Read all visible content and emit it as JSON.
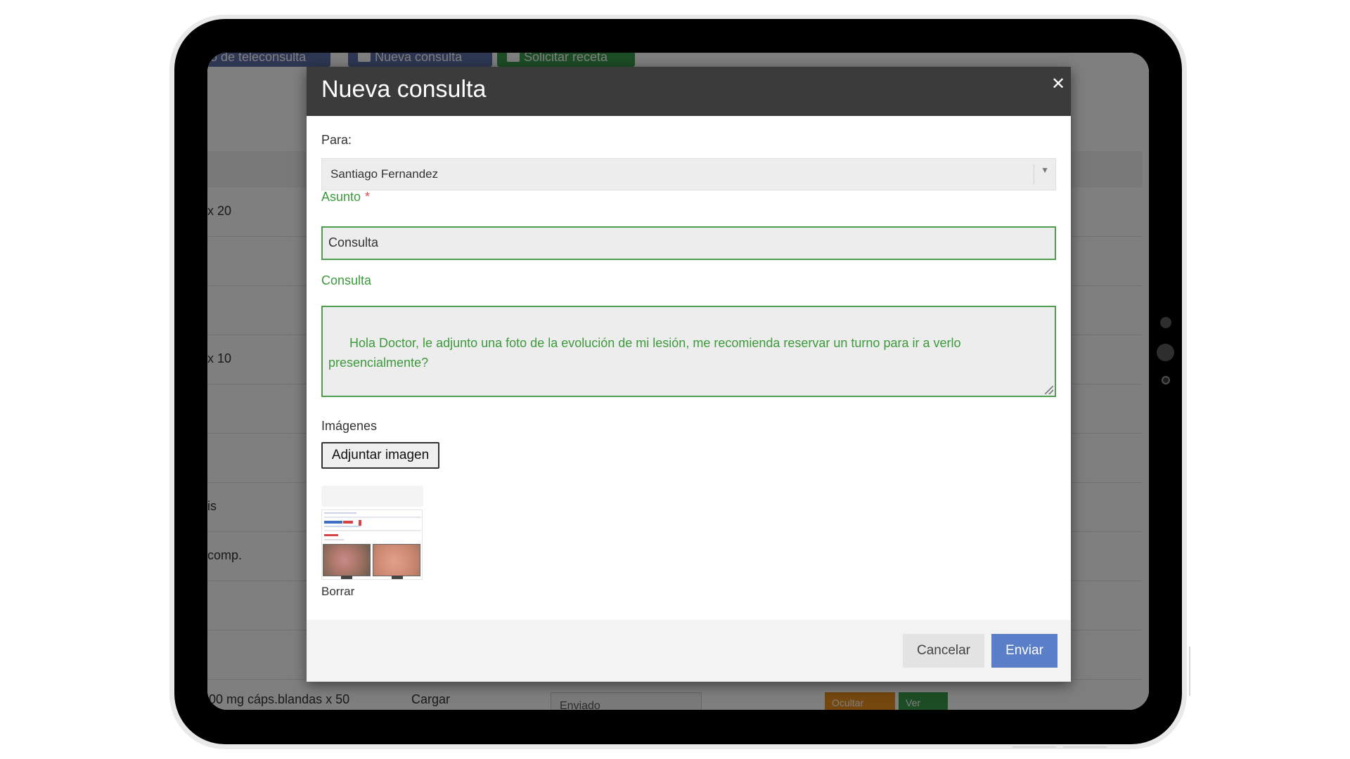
{
  "background": {
    "tabs": [
      {
        "label": "o de teleconsulta"
      },
      {
        "label": "Nueva consulta",
        "icon": "envelope-icon"
      },
      {
        "label": "Solicitar receta",
        "icon": "plus-icon"
      }
    ],
    "rows": [
      {
        "text": "x 20"
      },
      {
        "text": ""
      },
      {
        "text": ""
      },
      {
        "text": "x 10"
      },
      {
        "text": ""
      },
      {
        "text": ""
      },
      {
        "text": "is"
      },
      {
        "text": "comp."
      },
      {
        "text": ""
      },
      {
        "text": ""
      }
    ],
    "last_row": {
      "medication": "00 mg cáps.blandas x 50",
      "action": "Cargar",
      "status": "Enviado",
      "hide_label": "Ocultar",
      "view_label": "Ver"
    },
    "colors": {
      "tab_blue": "#5b6fa6",
      "tab_green": "#3b9b4a",
      "orange": "#e8901f"
    }
  },
  "modal": {
    "title": "Nueva consulta",
    "close_icon": "close-icon",
    "to_label": "Para:",
    "to_value": "Santiago Fernandez",
    "subject_label": "Asunto",
    "subject_required": "*",
    "subject_value": "Consulta",
    "message_label": "Consulta",
    "message_value": "Hola Doctor, le adjunto una foto de la evolución de mi lesión, me recomienda reservar un turno para ir a verlo presencialmente?\n\nSaludos.",
    "images_label": "Imágenes",
    "attach_button": "Adjuntar imagen",
    "delete_link": "Borrar",
    "cancel_button": "Cancelar",
    "send_button": "Enviar",
    "colors": {
      "header": "#3b3b3b",
      "valid_green": "#3c9a3c",
      "send_blue": "#5b7ec9"
    }
  }
}
